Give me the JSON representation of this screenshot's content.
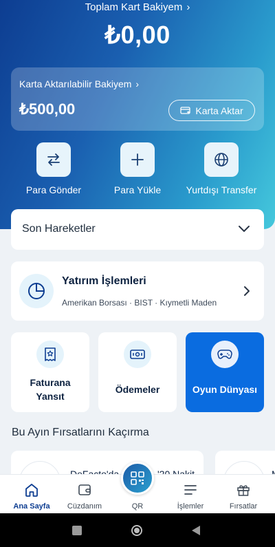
{
  "header": {
    "total_label": "Toplam Kart Bakiyem",
    "total_amount": "₺0,00"
  },
  "transfer_card": {
    "label": "Karta Aktarılabilir Bakiyem",
    "amount": "₺500,00",
    "button_label": "Karta Aktar"
  },
  "actions": [
    {
      "label": "Para Gönder",
      "icon": "swap-arrows-icon"
    },
    {
      "label": "Para Yükle",
      "icon": "plus-icon"
    },
    {
      "label": "Yurtdışı Transfer",
      "icon": "globe-icon"
    }
  ],
  "recent": {
    "label": "Son Hareketler",
    "icon": "chevron-down-icon"
  },
  "investment": {
    "title": "Yatırım İşlemleri",
    "subtitle": "Amerikan Borsası · BIST · Kıymetli Maden",
    "icon": "pie-chart-icon"
  },
  "tiles": [
    {
      "label_line1": "Faturana",
      "label_line2": "Yansıt",
      "icon": "receipt-star-icon"
    },
    {
      "label": "Ödemeler",
      "icon": "banknote-icon"
    },
    {
      "label": "Oyun Dünyası",
      "icon": "gamepad-icon"
    }
  ],
  "opportunities": {
    "title": "Bu Ayın Fırsatlarını Kaçırma",
    "card1_text": "DeFacto'da",
    "card1_text_right": "'20 Nakit",
    "card2_text": "M"
  },
  "nav": [
    {
      "label": "Ana Sayfa",
      "icon": "home-icon"
    },
    {
      "label": "Cüzdanım",
      "icon": "wallet-icon"
    },
    {
      "label": "QR",
      "icon": "qr-icon"
    },
    {
      "label": "İşlemler",
      "icon": "menu-lines-icon"
    },
    {
      "label": "Fırsatlar",
      "icon": "gift-icon"
    }
  ],
  "colors": {
    "primary": "#0a6ce0",
    "hero_start": "#0d3d91",
    "hero_end": "#45c8dc",
    "text_dark": "#0d2240"
  }
}
